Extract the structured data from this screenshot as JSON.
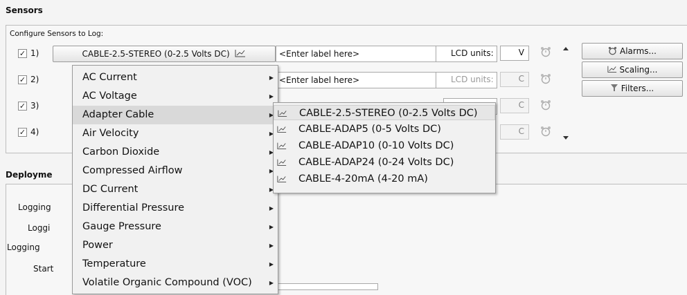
{
  "sensors": {
    "title": "Sensors",
    "configure_label": "Configure Sensors to Log:",
    "rows": [
      {
        "num": "1)",
        "checked": "✓",
        "sensor": "CABLE-2.5-STEREO (0-2.5 Volts DC)",
        "label_placeholder": "<Enter label here>",
        "lcd_label": "LCD units:",
        "unit": "V"
      },
      {
        "num": "2)",
        "checked": "✓",
        "label_placeholder": "<Enter label here>",
        "lcd_label": "LCD units:",
        "unit": "C"
      },
      {
        "num": "3)",
        "checked": "✓",
        "unit": "C"
      },
      {
        "num": "4)",
        "checked": "✓",
        "unit": "C"
      }
    ],
    "buttons": {
      "alarms": "Alarms...",
      "scaling": "Scaling...",
      "filters": "Filters..."
    }
  },
  "deployment": {
    "title": "Deployme",
    "labels": [
      "Logging",
      "Loggi",
      "Logging",
      "Start"
    ]
  },
  "menu": {
    "items": [
      {
        "label": "AC Current",
        "has_sub": true
      },
      {
        "label": "AC Voltage",
        "has_sub": true
      },
      {
        "label": "Adapter Cable",
        "has_sub": true,
        "highlighted": true
      },
      {
        "label": "Air Velocity",
        "has_sub": true
      },
      {
        "label": "Carbon Dioxide",
        "has_sub": true
      },
      {
        "label": "Compressed Airflow",
        "has_sub": true
      },
      {
        "label": "DC Current",
        "has_sub": true
      },
      {
        "label": "Differential Pressure",
        "has_sub": true
      },
      {
        "label": "Gauge Pressure",
        "has_sub": true
      },
      {
        "label": "Power",
        "has_sub": true
      },
      {
        "label": "Temperature",
        "has_sub": true
      },
      {
        "label": "Volatile Organic Compound (VOC)",
        "has_sub": true
      }
    ],
    "arrow_glyph": "▶"
  },
  "submenu": {
    "items": [
      {
        "label": "CABLE-2.5-STEREO (0-2.5 Volts DC)",
        "highlighted": true
      },
      {
        "label": "CABLE-ADAP5 (0-5 Volts DC)"
      },
      {
        "label": "CABLE-ADAP10 (0-10 Volts DC)"
      },
      {
        "label": "CABLE-ADAP24 (0-24 Volts DC)"
      },
      {
        "label": "CABLE-4-20mA (4-20 mA)"
      }
    ]
  },
  "icons": {
    "chart": "chart-icon",
    "alarm": "alarm-clock-icon",
    "filter": "filter-icon",
    "scroll_up": "scroll-up-arrow-icon",
    "scroll_down": "scroll-down-arrow-icon",
    "submenu_arrow": "submenu-arrow-icon"
  }
}
